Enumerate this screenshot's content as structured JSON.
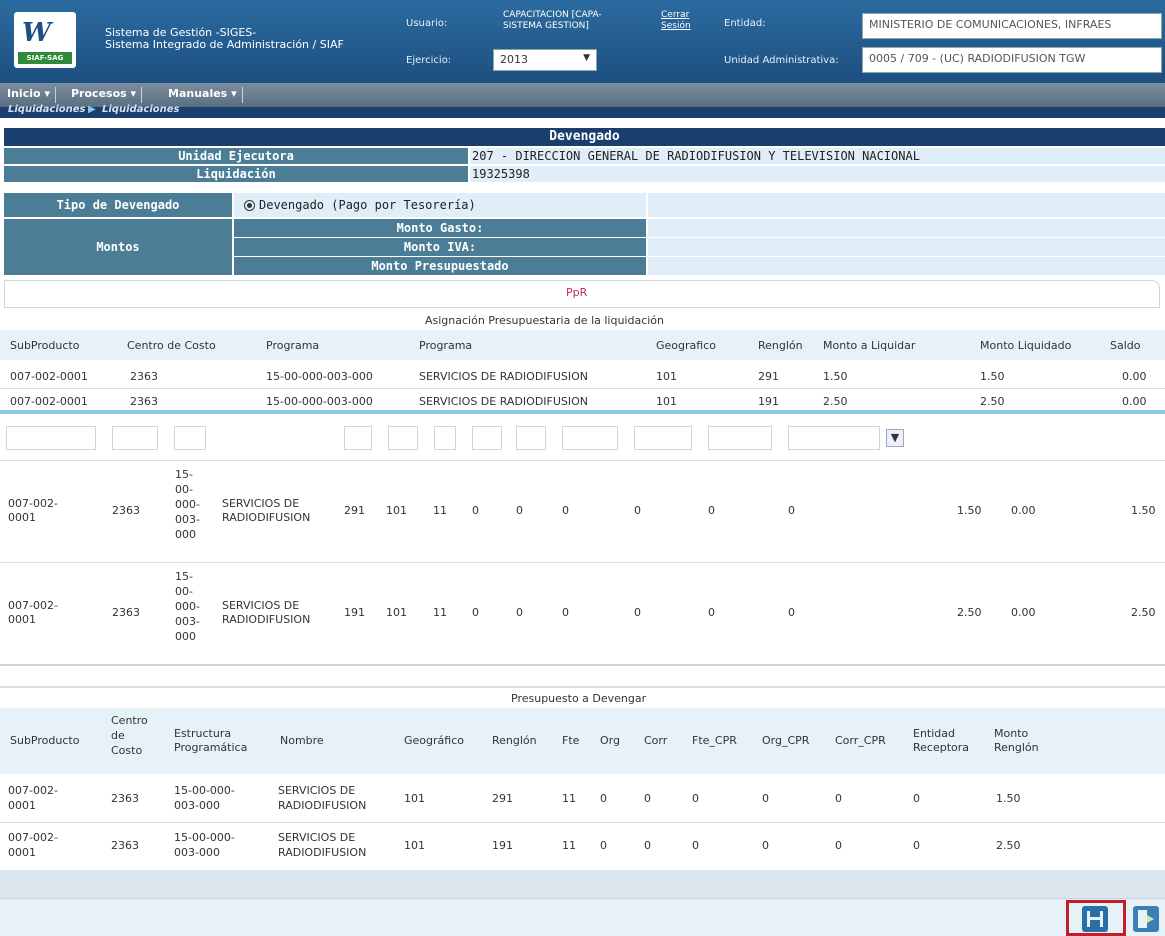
{
  "header": {
    "logo_text": "SIAF-SAG",
    "system_line1": "Sistema de Gestión -SIGES-",
    "system_line2": "Sistema Integrado de Administración / SIAF",
    "usuario_label": "Usuario:",
    "usuario_value_line1": "CAPACITACION [CAPA-",
    "usuario_value_line2": "SISTEMA GESTION]",
    "cerrar_line1": "Cerrar",
    "cerrar_line2": "Sesión",
    "entidad_label": "Entidad:",
    "entidad_value": "MINISTERIO DE COMUNICACIONES, INFRAES",
    "ejercicio_label": "Ejercicio:",
    "ejercicio_value": "2013",
    "unidad_label": "Unidad Administrativa:",
    "unidad_value": "0005 / 709 - (UC) RADIODIFUSION TGW"
  },
  "menu": {
    "items": [
      "Inicio",
      "Procesos",
      "Manuales"
    ]
  },
  "breadcrumb": {
    "item1": "Liquidaciones",
    "item2": "Liquidaciones"
  },
  "devengado": {
    "title": "Devengado",
    "unidad_ejecutora_label": "Unidad Ejecutora",
    "unidad_ejecutora_value": "207 - DIRECCION GENERAL DE RADIODIFUSION Y TELEVISION NACIONAL",
    "liquidacion_label": "Liquidación",
    "liquidacion_value": "19325398",
    "tipo_label": "Tipo de Devengado",
    "tipo_option": "Devengado (Pago por Tesorería)",
    "montos_label": "Montos",
    "monto_gasto": "Monto Gasto:",
    "monto_iva": "Monto IVA:",
    "monto_presupuestado": "Monto Presupuestado"
  },
  "ppr": {
    "label": "PpR"
  },
  "asignacion": {
    "title": "Asignación Presupuestaria de la liquidación",
    "columns": [
      "SubProducto",
      "Centro de Costo",
      "Programa",
      "Programa",
      "Geografico",
      "Renglón",
      "Monto a Liquidar",
      "Monto Liquidado",
      "Saldo"
    ],
    "rows": [
      [
        "007-002-0001",
        "2363",
        "15-00-000-003-000",
        "SERVICIOS DE RADIODIFUSION",
        "101",
        "291",
        "1.50",
        "1.50",
        "0.00"
      ],
      [
        "007-002-0001",
        "2363",
        "15-00-000-003-000",
        "SERVICIOS DE RADIODIFUSION",
        "101",
        "191",
        "2.50",
        "2.50",
        "0.00"
      ]
    ]
  },
  "detalle": {
    "rows": [
      {
        "subproducto_a": "007-002-",
        "subproducto_b": "0001",
        "centro": "2363",
        "prog": [
          "15-",
          "00-",
          "000-",
          "003-",
          "000"
        ],
        "nombre_a": "SERVICIOS DE",
        "nombre_b": "RADIODIFUSION",
        "renglon": "291",
        "geo": "101",
        "fte": "11",
        "c4": "0",
        "c5": "0",
        "c6": "0",
        "c7": "0",
        "c8": "0",
        "c9": "0",
        "monto": "1.50",
        "liquidado": "0.00",
        "saldo": "1.50"
      },
      {
        "subproducto_a": "007-002-",
        "subproducto_b": "0001",
        "centro": "2363",
        "prog": [
          "15-",
          "00-",
          "000-",
          "003-",
          "000"
        ],
        "nombre_a": "SERVICIOS DE",
        "nombre_b": "RADIODIFUSION",
        "renglon": "191",
        "geo": "101",
        "fte": "11",
        "c4": "0",
        "c5": "0",
        "c6": "0",
        "c7": "0",
        "c8": "0",
        "c9": "0",
        "monto": "2.50",
        "liquidado": "0.00",
        "saldo": "2.50"
      }
    ]
  },
  "presupuesto": {
    "title": "Presupuesto a Devengar",
    "col_subproducto": "SubProducto",
    "col_centro": [
      "Centro",
      "de",
      "Costo"
    ],
    "col_estructura": [
      "Estructura",
      "Programática"
    ],
    "col_nombre": "Nombre",
    "col_geografico": "Geográfico",
    "col_renglon": "Renglón",
    "col_fte": "Fte",
    "col_org": "Org",
    "col_corr": "Corr",
    "col_fte_cpr": "Fte_CPR",
    "col_org_cpr": "Org_CPR",
    "col_corr_cpr": "Corr_CPR",
    "col_entidad": [
      "Entidad",
      "Receptora"
    ],
    "col_monto": [
      "Monto",
      "Renglón"
    ],
    "rows": [
      {
        "sub_a": "007-002-",
        "sub_b": "0001",
        "centro": "2363",
        "est_a": "15-00-000-",
        "est_b": "003-000",
        "nom_a": "SERVICIOS DE",
        "nom_b": "RADIODIFUSION",
        "geo": "101",
        "renglon": "291",
        "fte": "11",
        "org": "0",
        "corr": "0",
        "fte_cpr": "0",
        "org_cpr": "0",
        "corr_cpr": "0",
        "entidad": "0",
        "monto": "1.50"
      },
      {
        "sub_a": "007-002-",
        "sub_b": "0001",
        "centro": "2363",
        "est_a": "15-00-000-",
        "est_b": "003-000",
        "nom_a": "SERVICIOS DE",
        "nom_b": "RADIODIFUSION",
        "geo": "101",
        "renglon": "191",
        "fte": "11",
        "org": "0",
        "corr": "0",
        "fte_cpr": "0",
        "org_cpr": "0",
        "corr_cpr": "0",
        "entidad": "0",
        "monto": "2.50"
      }
    ]
  },
  "footer": {
    "save_icon": "save-icon",
    "exit_icon": "exit-icon",
    "highlight_color": "#c0202a"
  }
}
